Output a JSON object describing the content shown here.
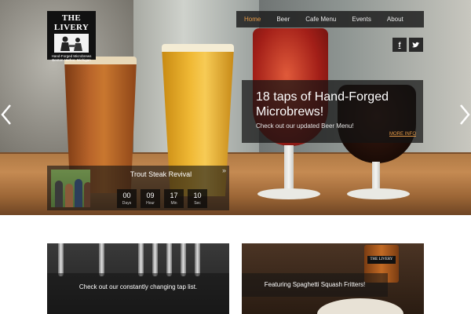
{
  "logo": {
    "title": "THE LIVERY",
    "subtitle_1": "Hand-Forged Microbrews",
    "subtitle_2": "Benton Harbor, Michigan"
  },
  "nav": {
    "items": [
      {
        "label": "Home",
        "active": true
      },
      {
        "label": "Beer",
        "active": false
      },
      {
        "label": "Cafe Menu",
        "active": false
      },
      {
        "label": "Events",
        "active": false
      },
      {
        "label": "About",
        "active": false
      }
    ]
  },
  "social": {
    "facebook": "f",
    "twitter": "t"
  },
  "slider": {
    "prev_icon": "chevron-left-icon",
    "next_icon": "chevron-right-icon",
    "caption": {
      "title": "18 taps of Hand-Forged Microbrews!",
      "subtitle": "Check out our updated Beer Menu!",
      "more": "MORE INFO"
    }
  },
  "event": {
    "title": "Trout Steak Revival",
    "expand_icon": "»",
    "countdown": [
      {
        "value": "00",
        "unit": "Days"
      },
      {
        "value": "09",
        "unit": "Hour"
      },
      {
        "value": "17",
        "unit": "Min"
      },
      {
        "value": "10",
        "unit": "Sec"
      }
    ]
  },
  "cards": {
    "left_label": "Check out our constantly changing tap list.",
    "right_label": "Featuring Spaghetti Squash Fritters!",
    "mug_text": "THE LIVERY"
  },
  "colors": {
    "accent": "#e59a47"
  }
}
